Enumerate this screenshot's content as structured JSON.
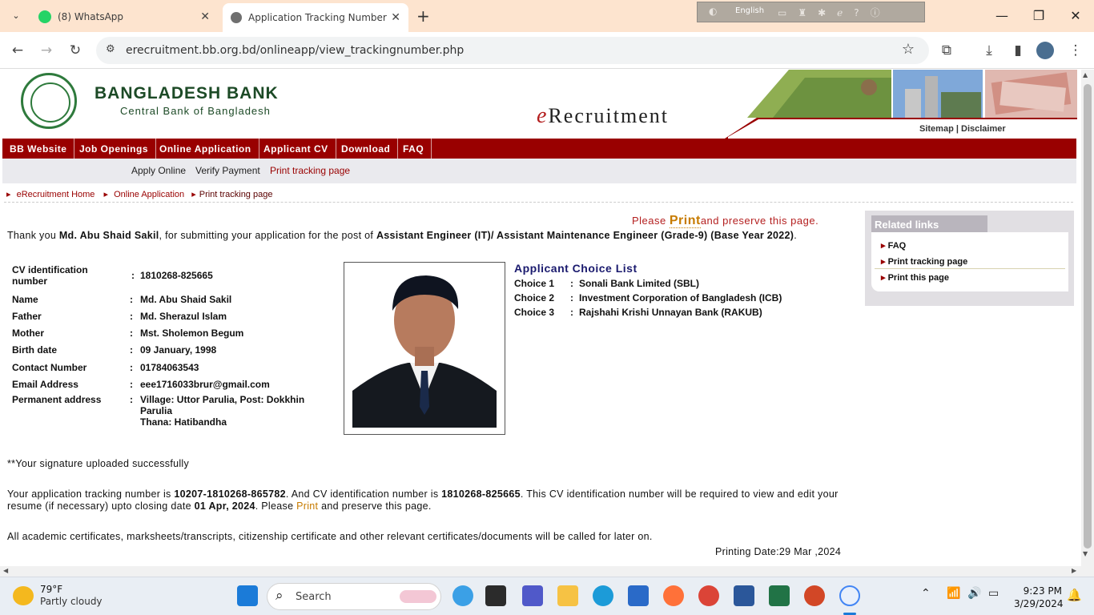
{
  "browser": {
    "tabs": [
      {
        "label": "(8) WhatsApp"
      },
      {
        "label": "Application Tracking Number"
      }
    ],
    "url": "erecruitment.bb.org.bd/onlineapp/view_trackingnumber.php",
    "ime_language": "English"
  },
  "header": {
    "bank_name": "BANGLADESH BANK",
    "bank_subtitle": "Central Bank of Bangladesh",
    "erecruitment_e": "e",
    "erecruitment_rest": "Recruitment",
    "sitemap": "Sitemap",
    "separator": "|",
    "disclaimer": "Disclaimer"
  },
  "menu": {
    "items": [
      "BB Website",
      "Job Openings",
      "Online Application",
      "Applicant CV",
      "Download",
      "FAQ"
    ],
    "sub_items": [
      "Apply Online",
      "Verify Payment",
      "Print tracking page"
    ]
  },
  "breadcrumb": [
    "eRecruitment Home",
    "Online Application",
    "Print tracking page"
  ],
  "main": {
    "please_prefix": "Please ",
    "please_print": "Print",
    "please_suffix": "and preserve this page.",
    "thanks_prefix": "Thank you ",
    "applicant_name": "Md. Abu Shaid Sakil",
    "thanks_middle": ", for submitting your application for the post of ",
    "post": "Assistant Engineer (IT)/ Assistant Maintenance Engineer (Grade-9) (Base Year 2022)",
    "thanks_end": ".",
    "fields": [
      {
        "label": "CV identification number",
        "value": "1810268-825665"
      },
      {
        "label": "Name",
        "value": "Md. Abu Shaid Sakil"
      },
      {
        "label": "Father",
        "value": "Md. Sherazul Islam"
      },
      {
        "label": "Mother",
        "value": "Mst. Sholemon Begum"
      },
      {
        "label": "Birth date",
        "value": "09 January, 1998"
      },
      {
        "label": "Contact Number",
        "value": "01784063543"
      },
      {
        "label": "Email Address",
        "value": "eee1716033brur@gmail.com"
      },
      {
        "label": "Permanent address",
        "value_line1": "Village: Uttor Parulia, Post: Dokkhin Parulia",
        "value_line2": "Thana: Hatibandha"
      }
    ],
    "colon": ":",
    "choice_heading": "Applicant Choice List",
    "choices": [
      {
        "label": "Choice 1",
        "value": "Sonali Bank Limited (SBL)"
      },
      {
        "label": "Choice 2",
        "value": "Investment Corporation of Bangladesh (ICB)"
      },
      {
        "label": "Choice 3",
        "value": "Rajshahi Krishi Unnayan Bank (RAKUB)"
      }
    ],
    "signature": "**Your signature uploaded successfully",
    "track_prefix": "Your application tracking number is ",
    "tracking_number": "10207-1810268-865782",
    "track_mid": ". And CV identification number is ",
    "cv_number": "1810268-825665",
    "track_mid2": ". This CV identification number will be required to view and edit your resume (if necessary) upto closing date ",
    "closing_date": "01 Apr, 2024",
    "track_mid3": ". Please ",
    "track_print": "Print",
    "track_end": " and preserve this page.",
    "academic": "All academic certificates, marksheets/transcripts, citizenship certificate and other relevant certificates/documents will be called for later on.",
    "printing_date": "Printing Date:29 Mar ,2024"
  },
  "related": {
    "heading": "Related links",
    "items": [
      "FAQ",
      "Print tracking page",
      "Print this page"
    ]
  },
  "taskbar": {
    "temperature": "79°F",
    "weather": "Partly cloudy",
    "search_placeholder": "Search",
    "time": "9:23 PM",
    "date": "3/29/2024"
  },
  "colors": {
    "menu_bg": "#990000",
    "tabstrip_bg": "#fde4cf",
    "print_orange": "#c77b00"
  }
}
